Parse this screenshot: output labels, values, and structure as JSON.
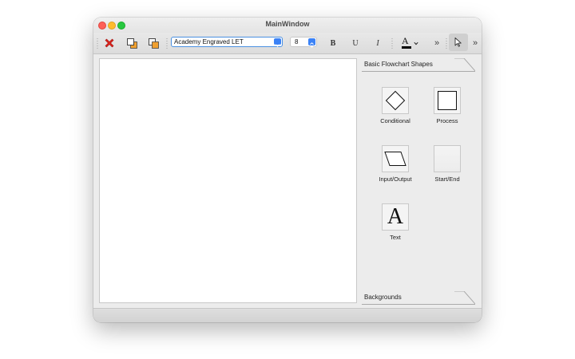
{
  "window": {
    "title": "MainWindow"
  },
  "toolbar": {
    "font_family": "Academy Engraved LET",
    "font_size": "8",
    "bold_label": "B",
    "underline_label": "U",
    "italic_label": "I",
    "text_color_glyph": "A",
    "overflow_glyph": "»",
    "icons": [
      "delete-icon",
      "bring-to-front-icon",
      "send-to-back-icon",
      "text-color-icon",
      "pointer-icon"
    ],
    "colors": {
      "delete": "#e0281e",
      "layer_orange": "#f0a030",
      "text_color": "#000000",
      "focus": "#4a90e2"
    }
  },
  "panel": {
    "sections": [
      {
        "label": "Basic Flowchart Shapes"
      },
      {
        "label": "Backgrounds"
      }
    ],
    "shapes": [
      {
        "label": "Conditional",
        "icon": "diamond-icon"
      },
      {
        "label": "Process",
        "icon": "square-icon"
      },
      {
        "label": "Input/Output",
        "icon": "parallelogram-icon"
      },
      {
        "label": "Start/End",
        "icon": "rounded-rect-icon"
      },
      {
        "label": "Text",
        "icon": "A"
      }
    ]
  }
}
